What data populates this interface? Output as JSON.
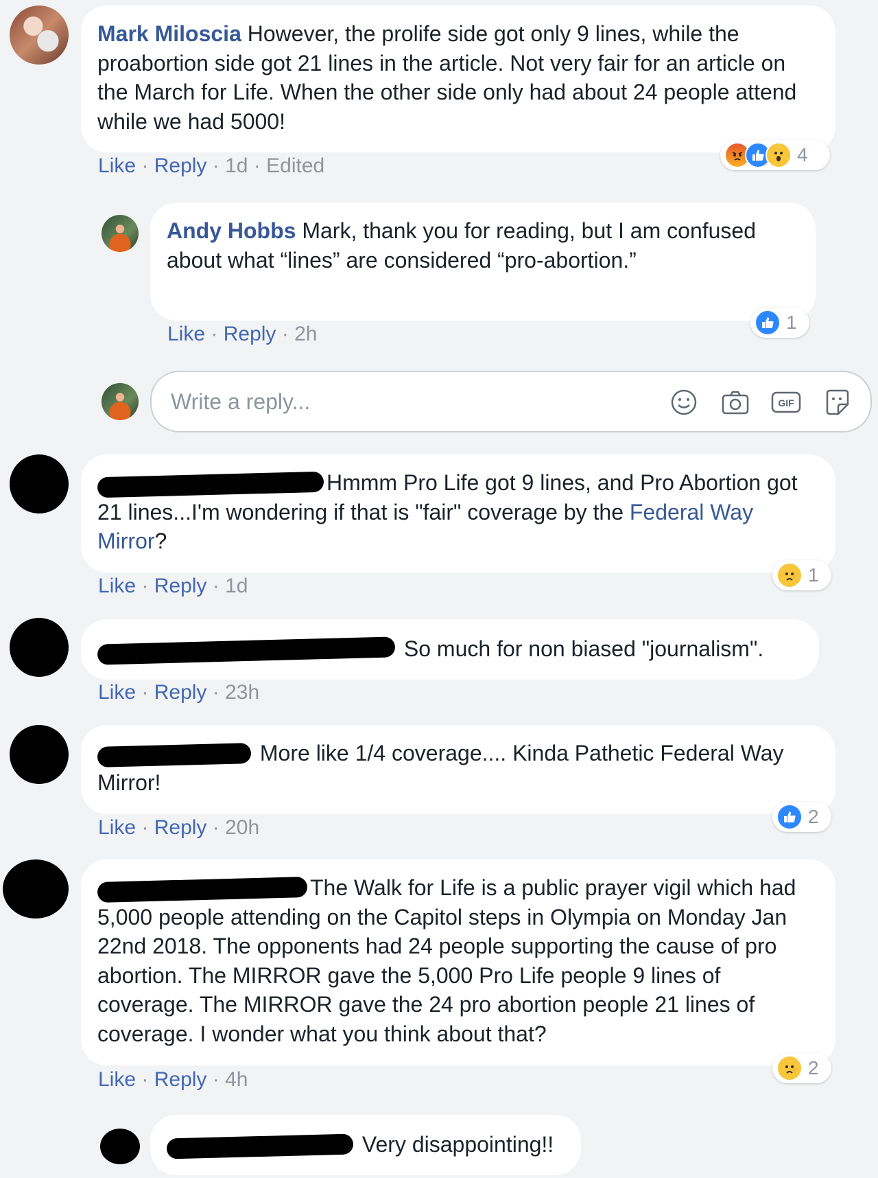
{
  "comments": [
    {
      "author": "Mark Miloscia",
      "text": "However, the prolife side got only 9 lines, while the proabortion side got 21 lines in the article. Not very fair for an article on the March for Life. When the other side only had about 24 people attend while we had 5000!",
      "like_label": "Like",
      "reply_label": "Reply",
      "time": "1d",
      "edited": "Edited",
      "reaction_count": "4"
    },
    {
      "author": "Andy Hobbs",
      "text": "Mark, thank you for reading, but I am confused about what “lines” are considered “pro-abortion.”",
      "like_label": "Like",
      "reply_label": "Reply",
      "time": "2h",
      "reaction_count": "1"
    },
    {
      "text_before": "Hmmm Pro Life got 9 lines, and Pro Abortion got 21 lines...I'm wondering if that is \"fair\" coverage by the ",
      "link": "Federal Way Mirror",
      "text_after": "?",
      "like_label": "Like",
      "reply_label": "Reply",
      "time": "1d",
      "reaction_count": "1"
    },
    {
      "text": "So much for non biased \"journalism\".",
      "like_label": "Like",
      "reply_label": "Reply",
      "time": "23h"
    },
    {
      "text": "More like 1/4 coverage.... Kinda Pathetic Federal Way Mirror!",
      "like_label": "Like",
      "reply_label": "Reply",
      "time": "20h",
      "reaction_count": "2"
    },
    {
      "text": "The Walk for Life is a public prayer vigil which had 5,000 people attending on the Capitol steps in Olympia on Monday Jan 22nd 2018. The opponents had 24 people supporting the cause of pro abortion. The MIRROR gave the 5,000 Pro Life people 9 lines of coverage. The MIRROR gave the 24 pro abortion people 21 lines of coverage. I wonder what you think about that?",
      "like_label": "Like",
      "reply_label": "Reply",
      "time": "4h",
      "reaction_count": "2"
    },
    {
      "text": "Very disappointing!!"
    }
  ],
  "reply_box": {
    "placeholder": "Write a reply...",
    "icons": [
      "smiley-icon",
      "camera-icon",
      "gif-icon",
      "sticker-icon"
    ]
  },
  "colors": {
    "link": "#365899",
    "action": "#4267b2",
    "meta": "#90949c",
    "like_blue": "#2d88ff"
  }
}
